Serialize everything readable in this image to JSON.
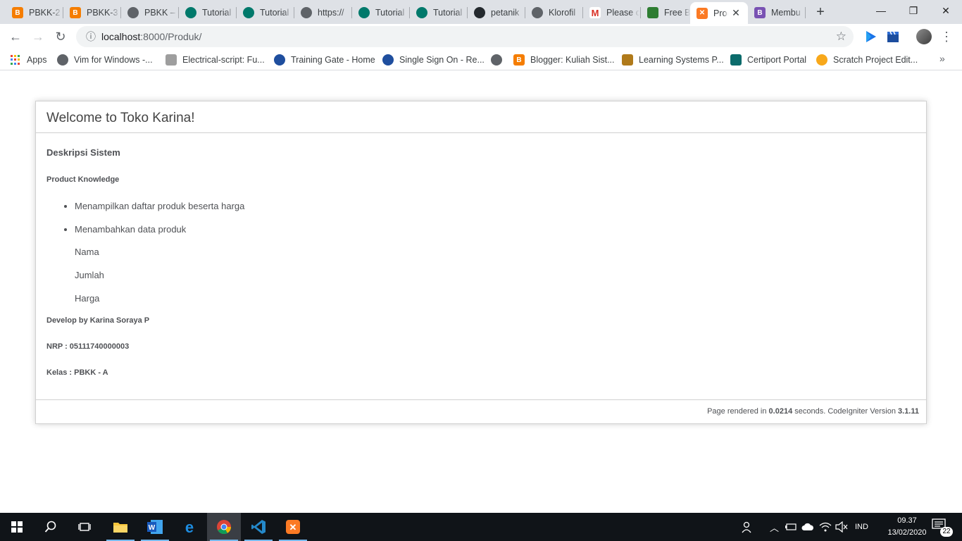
{
  "browser": {
    "tabs": [
      {
        "favicon": "blogger-icon",
        "title": "PBKK-2"
      },
      {
        "favicon": "blogger-icon",
        "title": "PBKK-3"
      },
      {
        "favicon": "globe-icon",
        "title": "PBKK –"
      },
      {
        "favicon": "teal-circle-icon",
        "title": "Tutorial"
      },
      {
        "favicon": "teal-circle-icon",
        "title": "Tutorial"
      },
      {
        "favicon": "globe-icon",
        "title": "https://"
      },
      {
        "favicon": "teal-circle-icon",
        "title": "Tutorial"
      },
      {
        "favicon": "teal-circle-icon",
        "title": "Tutorial"
      },
      {
        "favicon": "github-icon",
        "title": "petanik"
      },
      {
        "favicon": "globe-icon",
        "title": "Klorofil"
      },
      {
        "favicon": "gmail-icon",
        "title": "Please c"
      },
      {
        "favicon": "freebo-icon",
        "title": "Free Bo"
      },
      {
        "favicon": "xampp-icon",
        "title": "Prod",
        "active": true
      },
      {
        "favicon": "bootstrap-icon",
        "title": "Membu"
      }
    ],
    "new_tab": "+",
    "window_controls": {
      "minimize": "—",
      "maximize": "❐",
      "close": "✕"
    },
    "nav": {
      "back": "←",
      "forward": "→",
      "reload": "↻"
    },
    "address": {
      "host": "localhost",
      "rest": ":8000/Produk/",
      "info_icon": "ⓘ",
      "star": "☆"
    },
    "menu": "⋮",
    "bookmarks": [
      {
        "favicon": "apps-grid-icon",
        "label": "Apps"
      },
      {
        "favicon": "globe-icon",
        "label": "Vim for Windows -..."
      },
      {
        "favicon": "document-icon",
        "label": "Electrical-script: Fu..."
      },
      {
        "favicon": "training-gate-icon",
        "label": "Training Gate - Home"
      },
      {
        "favicon": "training-gate-icon",
        "label": "Single Sign On - Re..."
      },
      {
        "favicon": "globe-icon",
        "label": ""
      },
      {
        "favicon": "blogger-icon",
        "label": "Blogger: Kuliah Sist..."
      },
      {
        "favicon": "learning-systems-icon",
        "label": "Learning Systems P..."
      },
      {
        "favicon": "certiport-icon",
        "label": "Certiport Portal"
      },
      {
        "favicon": "scratch-icon",
        "label": "Scratch Project Edit..."
      }
    ],
    "bookmarks_more": "»"
  },
  "page": {
    "title": "Welcome to Toko Karina!",
    "section_heading": "Deskripsi Sistem",
    "subheading": "Product Knowledge",
    "features": [
      "Menampilkan daftar produk beserta harga",
      "Menambahkan data produk"
    ],
    "fields": [
      "Nama",
      "Jumlah",
      "Harga"
    ],
    "developer": "Develop by Karina Soraya P",
    "nrp": "NRP : 05111740000003",
    "kelas": "Kelas : PBKK - A",
    "footer": {
      "prefix": "Page rendered in ",
      "time": "0.0214",
      "middle": " seconds. CodeIgniter Version ",
      "version": "3.1.11"
    }
  },
  "taskbar": {
    "apps": [
      {
        "name": "start",
        "icon": "windows-start-icon"
      },
      {
        "name": "search",
        "icon": "search-icon"
      },
      {
        "name": "task-view",
        "icon": "task-view-icon"
      },
      {
        "name": "file-explorer",
        "icon": "folder-icon"
      },
      {
        "name": "word",
        "icon": "word-icon"
      },
      {
        "name": "edge",
        "icon": "edge-icon"
      },
      {
        "name": "chrome",
        "icon": "chrome-icon",
        "active": true
      },
      {
        "name": "vscode",
        "icon": "vscode-icon"
      },
      {
        "name": "xampp",
        "icon": "xampp-icon"
      }
    ],
    "language": "IND",
    "time": "09.37",
    "date": "13/02/2020",
    "notifications": "22"
  },
  "colors": {
    "tabstrip": "#dee1e6",
    "taskbar": "#101418",
    "chrome_accent": "#1a73e8",
    "text": "#4f5155"
  }
}
